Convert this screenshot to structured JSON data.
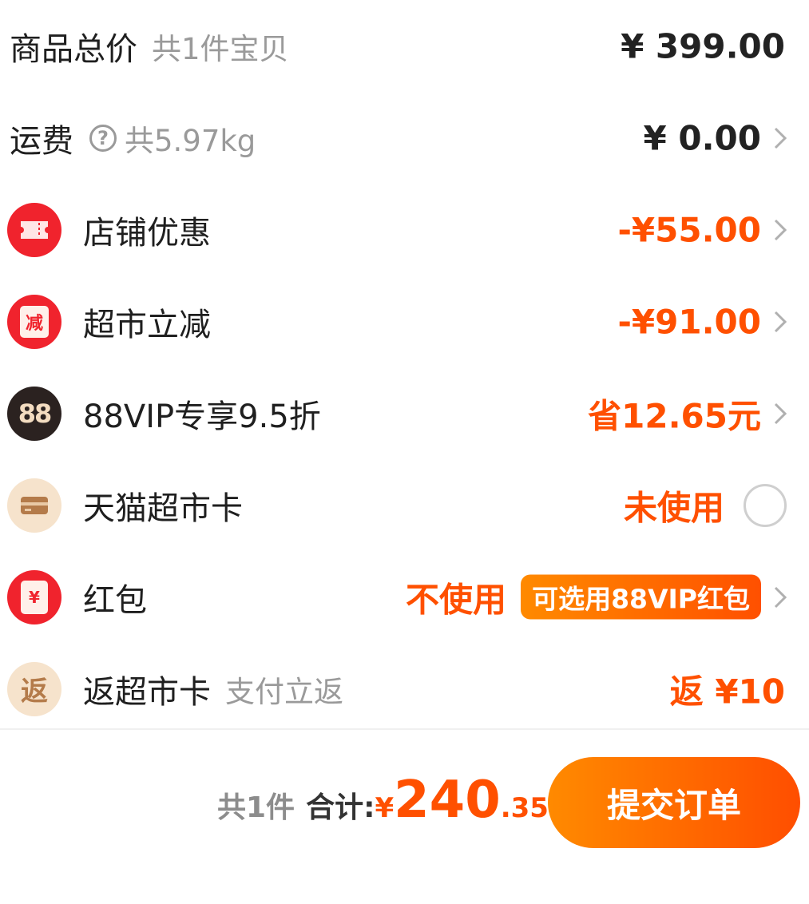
{
  "summary": {
    "goods": {
      "label": "商品总价",
      "sub": "共1件宝贝",
      "amount": "¥ 399.00"
    },
    "shipping": {
      "label": "运费",
      "help_icon": "?",
      "sub": "共5.97kg",
      "amount": "¥ 0.00"
    }
  },
  "discounts": {
    "store": {
      "label": "店铺优惠",
      "amount": "-¥55.00",
      "icon": "ticket-icon"
    },
    "market": {
      "label": "超市立减",
      "amount": "-¥91.00",
      "icon_text": "减"
    },
    "vip": {
      "label": "88VIP专享9.5折",
      "amount": "省12.65元",
      "icon_text": "88"
    },
    "card": {
      "label": "天猫超市卡",
      "status": "未使用",
      "icon": "card-icon"
    },
    "redpacket": {
      "label": "红包",
      "status": "不使用",
      "badge": "可选用88VIP红包",
      "icon_text": "¥"
    },
    "cashback": {
      "label": "返超市卡",
      "sub": "支付立返",
      "amount": "返 ¥10",
      "icon_text": "返"
    }
  },
  "footer": {
    "count": "共1件",
    "total_label": "合计:",
    "currency": "¥",
    "total_int": "240",
    "total_dec": ".35",
    "submit_label": "提交订单"
  },
  "colors": {
    "accent": "#ff5000",
    "red_icon": "#f0232d",
    "vip_icon": "#2b2220",
    "gold_icon": "#f3dcc0"
  }
}
